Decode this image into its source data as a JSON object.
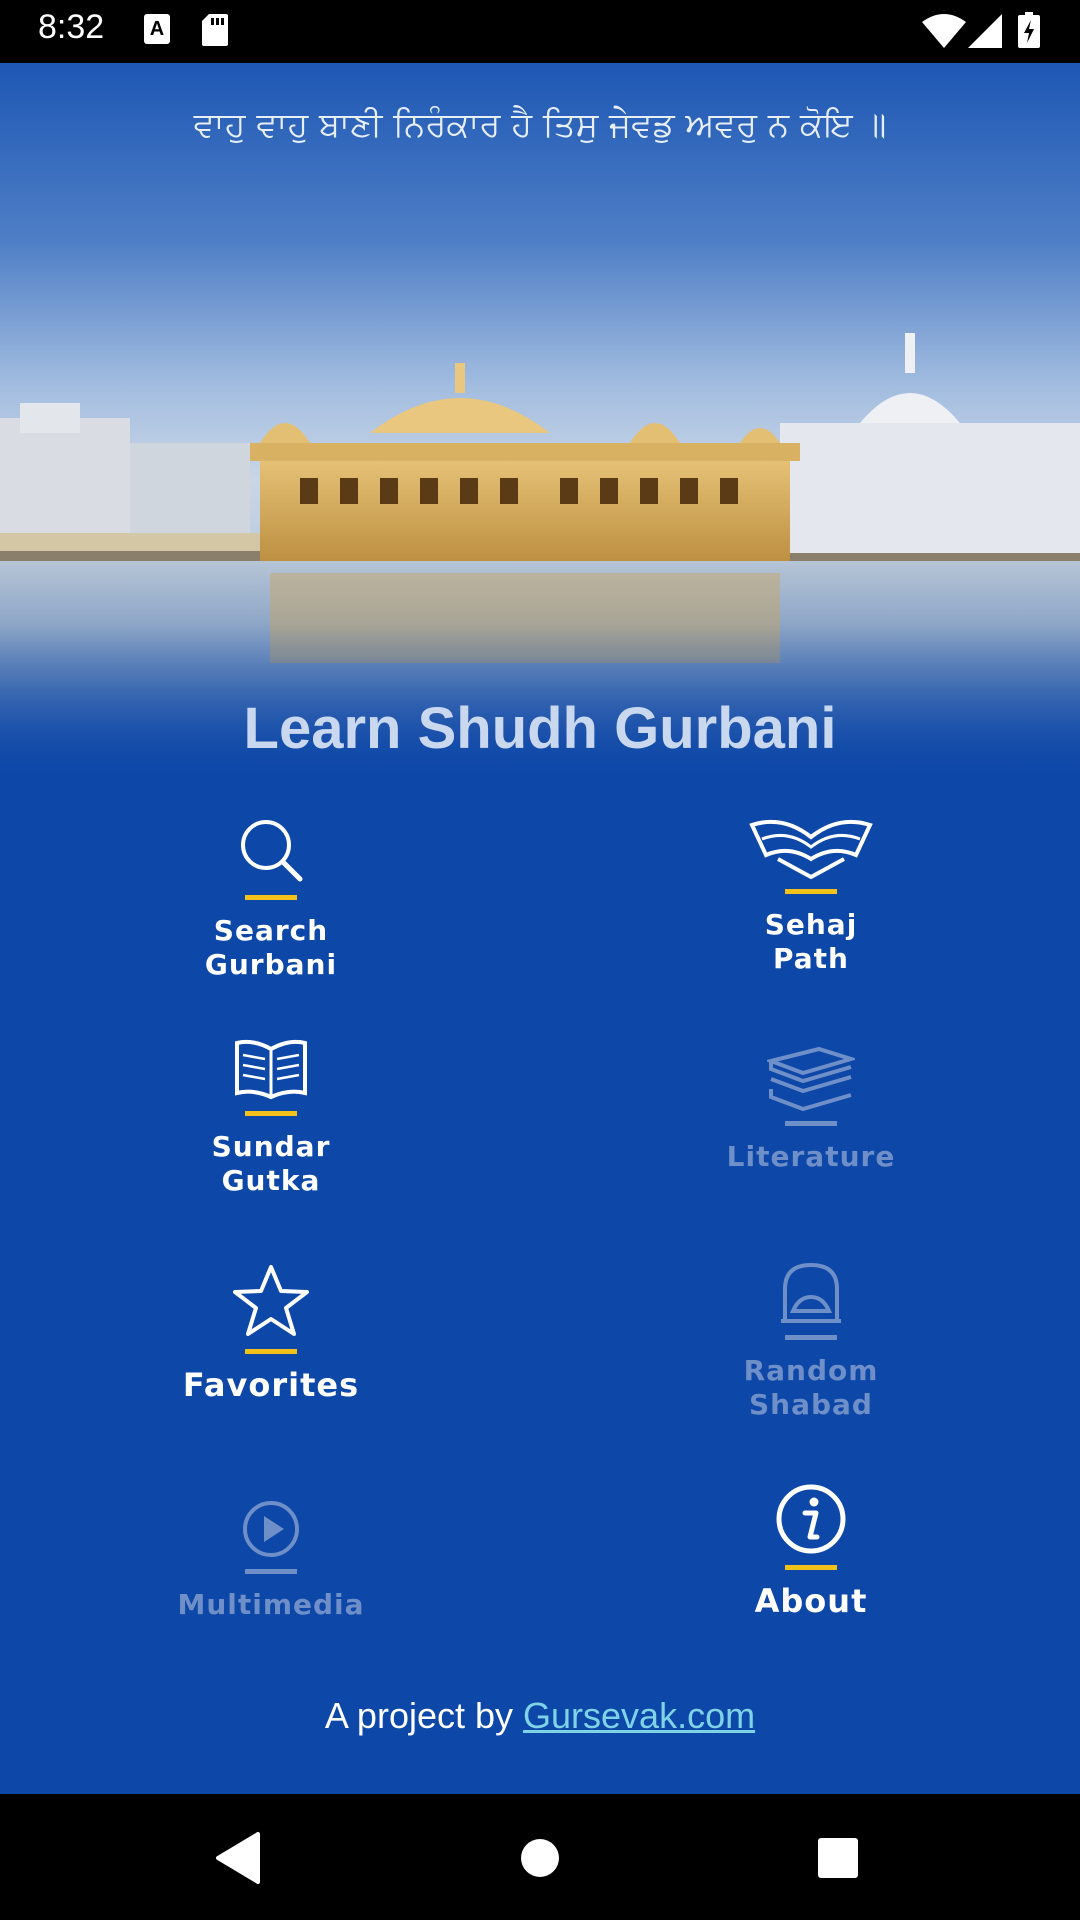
{
  "status_bar": {
    "time": "8:32",
    "icons": [
      "a-notification-icon",
      "sd-card-icon",
      "wifi-icon",
      "cell-signal-icon",
      "battery-icon"
    ]
  },
  "header": {
    "gurbani_line": "ਵਾਹੁ ਵਾਹੁ ਬਾਣੀ ਨਿਰੰਕਾਰ ਹੈ ਤਿਸੁ ਜੇਵਡੁ ਅਵਰੁ ਨ ਕੋਇ ॥",
    "title": "Learn Shudh Gurbani"
  },
  "menu": {
    "search": {
      "label": "Search\nGurbani",
      "icon": "search-icon",
      "enabled": true
    },
    "sehaj": {
      "label": "Sehaj\nPath",
      "icon": "open-book-icon",
      "enabled": true
    },
    "sundar": {
      "label": "Sundar\nGutka",
      "icon": "book-icon",
      "enabled": true
    },
    "literature": {
      "label": "Literature",
      "icon": "books-stack-icon",
      "enabled": false
    },
    "favorites": {
      "label": "Favorites",
      "icon": "star-icon",
      "enabled": true
    },
    "random": {
      "label": "Random\nShabad",
      "icon": "shrine-icon",
      "enabled": false
    },
    "multimedia": {
      "label": "Multimedia",
      "icon": "play-icon",
      "enabled": false
    },
    "about": {
      "label": "About",
      "icon": "info-icon",
      "enabled": true
    }
  },
  "footer": {
    "prefix": "A project by ",
    "link": "Gursevak.com"
  },
  "colors": {
    "background": "#0d47a8",
    "accent": "#f2c21a",
    "disabled": "#6f8fc8",
    "link": "#7fd3e6"
  }
}
